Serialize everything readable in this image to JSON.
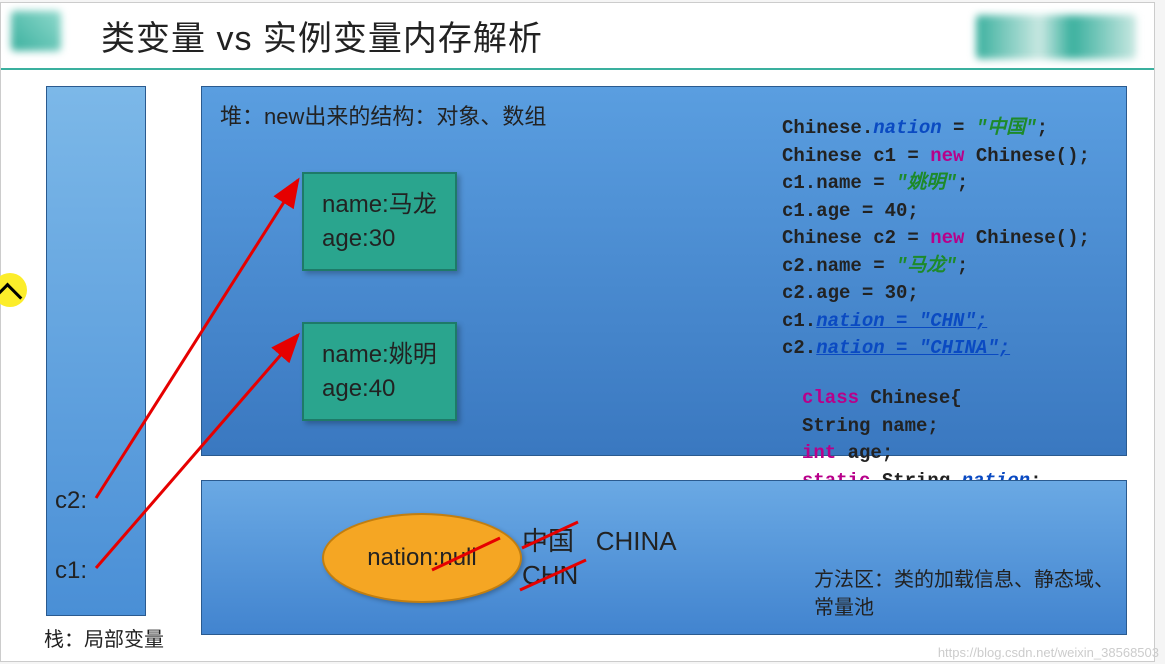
{
  "title": "类变量 vs 实例变量内存解析",
  "stack": {
    "label": "栈：局部变量",
    "vars": {
      "c2": "c2:",
      "c1": "c1:"
    }
  },
  "heap": {
    "label": "堆：new出来的结构：对象、数组",
    "obj1": {
      "name_line": "name:马龙",
      "age_line": "age:30"
    },
    "obj2": {
      "name_line": "name:姚明",
      "age_line": "age:40"
    }
  },
  "code": {
    "l1a": "Chinese.",
    "l1b": "nation",
    "l1c": " = ",
    "l1d": "\"中国\"",
    "l1e": ";",
    "l2a": "Chinese c1 = ",
    "l2b": "new",
    "l2c": " Chinese();",
    "l3a": "c1.name = ",
    "l3b": "\"姚明\"",
    "l3c": ";",
    "l4a": "c1.age = 40;",
    "l5a": "Chinese c2 = ",
    "l5b": "new",
    "l5c": " Chinese();",
    "l6a": "c2.name = ",
    "l6b": "\"马龙\"",
    "l6c": ";",
    "l7a": "c2.age = 30;",
    "l8a": "c1.",
    "l8b": "nation = \"CHN\";",
    "l9a": "c2.",
    "l9b": "nation = \"CHINA\";"
  },
  "class_def": {
    "l1a": "class",
    "l1b": " Chinese{",
    "l2": "String name;",
    "l3a": "int",
    "l3b": " age;",
    "l4a": "static",
    "l4b": " String ",
    "l4c": "nation",
    "l4d": ";",
    "l5": "}"
  },
  "method_area": {
    "label": "方法区：类的加载信息、静态域、常量池",
    "ellipse": "nation:null",
    "vals": {
      "cn": "中国",
      "china": "CHINA",
      "chn": "CHN"
    }
  },
  "watermark": "https://blog.csdn.net/weixin_38568503"
}
